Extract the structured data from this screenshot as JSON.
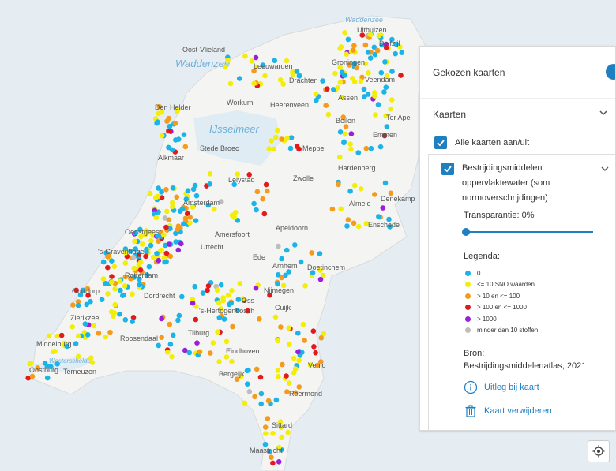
{
  "map": {
    "water_labels": [
      "Waddenzee",
      "Waddenzee",
      "IJsselmeer",
      "Westerschelde"
    ],
    "places": [
      "Oost-Vlieland",
      "Uithuizen",
      "Delfzijl",
      "Leeuwarden",
      "Groningen",
      "Drachten",
      "Veendam",
      "Heerenveen",
      "Workum",
      "Assen",
      "Den Helder",
      "Beilen",
      "Ter Apel",
      "Emmen",
      "Stede Broec",
      "Meppel",
      "Alkmaar",
      "Lelystad",
      "Zwolle",
      "Hardenberg",
      "Amsterdam",
      "Almelo",
      "Denekamp",
      "Enschede",
      "Apeldoorn",
      "Amersfoort",
      "Oegstgeest",
      "'s-Gravenhage",
      "Utrecht",
      "Ede",
      "Arnhem",
      "Doetinchem",
      "Rotterdam",
      "Nijmegen",
      "Ouddorp",
      "Dordrecht",
      "Oss",
      "Cuijk",
      "Zierikzee",
      "'s-Hertogenbosch",
      "Roosendaal",
      "Tilburg",
      "Middelburg",
      "Eindhoven",
      "Venlo",
      "Oostburg",
      "Terneuzen",
      "Bergeijk",
      "Roermond",
      "Sittard",
      "Maastricht"
    ]
  },
  "panel": {
    "header": "Gekozen kaarten",
    "section": "Kaarten",
    "all_toggle": "Alle kaarten aan/uit",
    "layer": {
      "title": "Bestrijdingsmiddelen oppervlaktewater (som normoverschrijdingen)",
      "transparency_label": "Transparantie: 0%",
      "transparency_value": 0,
      "legend_title": "Legenda:",
      "legend": [
        {
          "label": "0",
          "color": "#1ab4e8"
        },
        {
          "label": "<= 10 SNO waarden",
          "color": "#f2ee0a"
        },
        {
          "label": "> 10 en <= 100",
          "color": "#f59a1b"
        },
        {
          "label": "> 100 en <= 1000",
          "color": "#e31a1c"
        },
        {
          "label": "> 1000",
          "color": "#9b1fd8"
        },
        {
          "label": "minder dan 10 stoffen",
          "color": "#bdbdbd"
        }
      ],
      "source_label": "Bron:",
      "source_value": "Bestrijdingsmiddelenatlas, 2021",
      "explain_action": "Uitleg bij kaart",
      "remove_action": "Kaart verwijderen"
    }
  },
  "icons": {
    "info": "info-circle-icon",
    "trash": "trash-icon",
    "locate": "locate-icon",
    "chevron": "chevron-down-icon",
    "check": "checkmark-icon"
  }
}
